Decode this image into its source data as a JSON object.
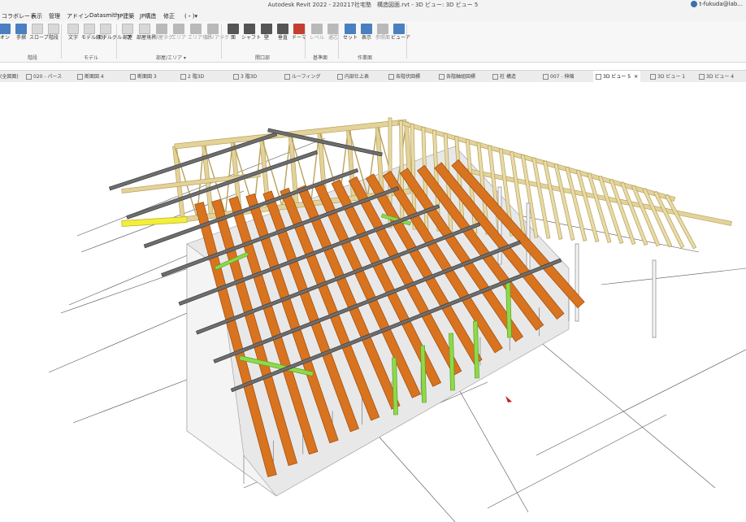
{
  "app": {
    "title": "Autodesk Revit 2022 - 220217社宅塾　構造図面.rvt - 3D ビュー: 3D ビュー 5",
    "user": "t-fukuda@lab..."
  },
  "menubar": {
    "items": [
      "コラボレート",
      "表示",
      "管理",
      "アドイン",
      "Datasmith",
      "JP建築",
      "JP構造",
      "修正",
      "(・)▾"
    ]
  },
  "ribbon": {
    "buttons": [
      {
        "label": "オン",
        "icon": "blue"
      },
      {
        "label": "手摺",
        "icon": "blue"
      },
      {
        "label": "スロープ",
        "icon": "light"
      },
      {
        "label": "階段",
        "icon": "light"
      },
      {
        "label": "文字",
        "icon": "light"
      },
      {
        "label": "モデル線分",
        "icon": "light"
      },
      {
        "label": "モデルグループ",
        "icon": "light"
      },
      {
        "label": "部屋",
        "icon": "light"
      },
      {
        "label": "部屋境界",
        "icon": "light"
      },
      {
        "label": "部屋タグ",
        "icon": "grey"
      },
      {
        "label": "エリア",
        "icon": "grey"
      },
      {
        "label": "エリア境界",
        "icon": "grey"
      },
      {
        "label": "エリアタグ",
        "icon": "grey"
      },
      {
        "label": "面",
        "icon": "dark"
      },
      {
        "label": "シャフト",
        "icon": "dark"
      },
      {
        "label": "壁",
        "icon": "dark"
      },
      {
        "label": "垂直",
        "icon": "dark"
      },
      {
        "label": "ドーマ",
        "icon": "red"
      },
      {
        "label": "レベル",
        "icon": "grey"
      },
      {
        "label": "通芯",
        "icon": "grey"
      },
      {
        "label": "セット",
        "icon": "blue"
      },
      {
        "label": "表示",
        "icon": "blue"
      },
      {
        "label": "参照面",
        "icon": "grey"
      },
      {
        "label": "ビューア",
        "icon": "blue"
      }
    ],
    "panels": [
      "階段",
      "モデル",
      "部屋/エリア ▾",
      "開口部",
      "基準面",
      "作業面"
    ]
  },
  "tabs": {
    "items": [
      {
        "label": "(全図面)"
      },
      {
        "label": "020 - パース"
      },
      {
        "label": "断面図 4"
      },
      {
        "label": "断面図 3"
      },
      {
        "label": "2 階3D"
      },
      {
        "label": "3 階3D"
      },
      {
        "label": "ルーフィング"
      },
      {
        "label": "内部仕上表"
      },
      {
        "label": "各階伏図標"
      },
      {
        "label": "各階軸組図標"
      },
      {
        "label": "柱 構造"
      },
      {
        "label": "007 - 伸縮"
      },
      {
        "label": "3D ビュー 5"
      },
      {
        "label": "3D ビュー 1"
      },
      {
        "label": "3D ビュー 4"
      }
    ],
    "close_glyph": "✕"
  },
  "colors": {
    "rafter_orange": "#d8731f",
    "rafter_dark": "#9c4b0e",
    "steel_grey": "#6e6e6e",
    "timber_light": "#e3d39a",
    "timber_dark": "#b8a25c",
    "brace_green": "#8fd94a",
    "wall_grey": "#e8e8e8",
    "yellow_beam": "#f2ee3a"
  }
}
